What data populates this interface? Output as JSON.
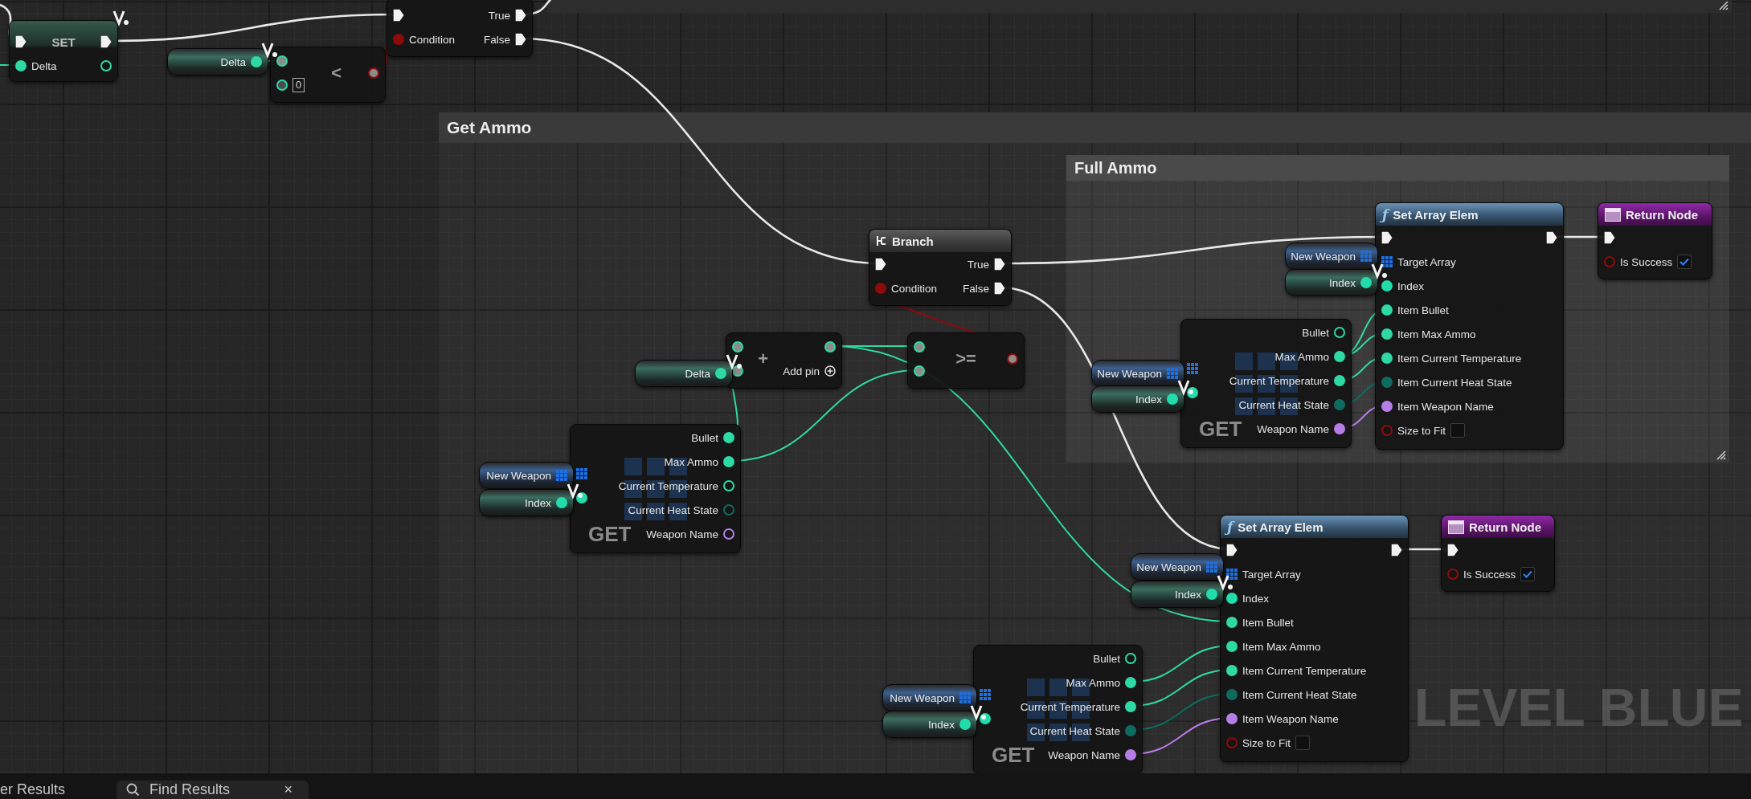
{
  "comments": [
    {
      "title": "Get Ammo"
    },
    {
      "title": "Full Ammo"
    }
  ],
  "nodes": [
    {
      "kind": "set",
      "title": "SET",
      "inputs": [
        {
          "kind": "exec",
          "connected": true
        },
        {
          "label": "Delta",
          "kind": "float",
          "connected": true
        }
      ],
      "outputs": [
        {
          "kind": "exec",
          "connected": true
        },
        {
          "kind": "float",
          "connected": false
        }
      ]
    },
    {
      "kind": "getter",
      "label": "Delta",
      "pin": {
        "kind": "float",
        "connected": true
      }
    },
    {
      "kind": "operator",
      "symbol": "<",
      "inputs": [
        {
          "kind": "wildcard",
          "connected": true
        },
        {
          "kind": "wildcard",
          "connected": false,
          "literal": "0"
        }
      ],
      "outputs": [
        {
          "kind": "wildcard_bool",
          "connected": true
        }
      ]
    },
    {
      "kind": "branch",
      "inputs": [
        {
          "kind": "exec",
          "connected": true
        },
        {
          "label": "Condition",
          "kind": "bool",
          "connected": true
        }
      ],
      "outputs": [
        {
          "label": "True",
          "kind": "exec",
          "connected": true
        },
        {
          "label": "False",
          "kind": "exec",
          "connected": true
        }
      ]
    },
    {
      "kind": "branch",
      "title": "Branch",
      "inputs": [
        {
          "kind": "exec",
          "connected": true
        },
        {
          "label": "Condition",
          "kind": "bool",
          "connected": true
        }
      ],
      "outputs": [
        {
          "label": "True",
          "kind": "exec",
          "connected": true
        },
        {
          "label": "False",
          "kind": "exec",
          "connected": true
        }
      ]
    },
    {
      "kind": "getter",
      "label": "Delta",
      "pin": {
        "kind": "float",
        "connected": true
      }
    },
    {
      "kind": "add",
      "symbol": "+",
      "add_pin": "Add pin",
      "inputs": [
        {
          "kind": "wildcard",
          "connected": true
        },
        {
          "kind": "wildcard",
          "connected": true
        }
      ],
      "outputs": [
        {
          "kind": "wildcard",
          "connected": true
        }
      ]
    },
    {
      "kind": "operator",
      "symbol": ">=",
      "inputs": [
        {
          "kind": "wildcard",
          "connected": true
        },
        {
          "kind": "wildcard",
          "connected": true
        }
      ],
      "outputs": [
        {
          "kind": "wildcard_bool",
          "connected": true
        }
      ]
    },
    {
      "kind": "get",
      "title": "GET",
      "inputs": [
        {
          "kind": "array",
          "connected": true
        },
        {
          "kind": "int",
          "connected": true
        }
      ],
      "outputs": [
        {
          "label": "Bullet",
          "kind": "float",
          "connected": true
        },
        {
          "label": "Max Ammo",
          "kind": "float",
          "connected": true
        },
        {
          "label": "Current Temperature",
          "kind": "float",
          "connected": false
        },
        {
          "label": "Current Heat State",
          "kind": "enum",
          "connected": false
        },
        {
          "label": "Weapon Name",
          "kind": "name",
          "connected": false
        }
      ]
    },
    {
      "kind": "getter",
      "label": "New Weapon",
      "pin": {
        "kind": "array",
        "connected": true
      }
    },
    {
      "kind": "getter",
      "label": "Index",
      "pin": {
        "kind": "int",
        "connected": true
      }
    },
    {
      "kind": "getter",
      "label": "New Weapon",
      "pin": {
        "kind": "array",
        "connected": true
      }
    },
    {
      "kind": "getter",
      "label": "Index",
      "pin": {
        "kind": "int",
        "connected": true
      }
    },
    {
      "kind": "function",
      "icon": "ƒ",
      "title": "Set Array Elem",
      "inputs": [
        {
          "kind": "exec",
          "connected": true
        },
        {
          "label": "Target Array",
          "kind": "array",
          "connected": true
        },
        {
          "label": "Index",
          "kind": "int",
          "connected": true
        },
        {
          "label": "Item Bullet",
          "kind": "float",
          "connected": true
        },
        {
          "label": "Item Max Ammo",
          "kind": "float",
          "connected": true
        },
        {
          "label": "Item Current Temperature",
          "kind": "float",
          "connected": true
        },
        {
          "label": "Item Current Heat State",
          "kind": "enum",
          "connected": true
        },
        {
          "label": "Item Weapon Name",
          "kind": "name",
          "connected": true
        },
        {
          "label": "Size to Fit",
          "kind": "bool",
          "connected": false,
          "checked": false
        }
      ],
      "outputs": [
        {
          "kind": "exec",
          "connected": true
        }
      ]
    },
    {
      "kind": "return",
      "title": "Return Node",
      "inputs": [
        {
          "kind": "exec",
          "connected": true
        },
        {
          "label": "Is Success",
          "kind": "bool",
          "connected": false,
          "checked": true
        }
      ]
    },
    {
      "kind": "getter",
      "label": "New Weapon",
      "pin": {
        "kind": "array",
        "connected": true
      }
    },
    {
      "kind": "getter",
      "label": "Index",
      "pin": {
        "kind": "int",
        "connected": true
      }
    },
    {
      "kind": "get",
      "title": "GET",
      "inputs": [
        {
          "kind": "array",
          "connected": true
        },
        {
          "kind": "int",
          "connected": true
        }
      ],
      "outputs": [
        {
          "label": "Bullet",
          "kind": "float",
          "connected": false
        },
        {
          "label": "Max Ammo",
          "kind": "float",
          "connected": true
        },
        {
          "label": "Current Temperature",
          "kind": "float",
          "connected": true
        },
        {
          "label": "Current Heat State",
          "kind": "enum",
          "connected": true
        },
        {
          "label": "Weapon Name",
          "kind": "name",
          "connected": true
        }
      ]
    },
    {
      "kind": "getter",
      "label": "New Weapon",
      "pin": {
        "kind": "array",
        "connected": true
      }
    },
    {
      "kind": "getter",
      "label": "Index",
      "pin": {
        "kind": "int",
        "connected": true
      }
    },
    {
      "kind": "function",
      "icon": "ƒ",
      "title": "Set Array Elem",
      "inputs": [
        {
          "kind": "exec",
          "connected": true
        },
        {
          "label": "Target Array",
          "kind": "array",
          "connected": true
        },
        {
          "label": "Index",
          "kind": "int",
          "connected": true
        },
        {
          "label": "Item Bullet",
          "kind": "float",
          "connected": true
        },
        {
          "label": "Item Max Ammo",
          "kind": "float",
          "connected": true
        },
        {
          "label": "Item Current Temperature",
          "kind": "float",
          "connected": true
        },
        {
          "label": "Item Current Heat State",
          "kind": "enum",
          "connected": true
        },
        {
          "label": "Item Weapon Name",
          "kind": "name",
          "connected": true
        },
        {
          "label": "Size to Fit",
          "kind": "bool",
          "connected": false,
          "checked": false
        }
      ],
      "outputs": [
        {
          "kind": "exec",
          "connected": true
        }
      ]
    },
    {
      "kind": "return",
      "title": "Return Node",
      "inputs": [
        {
          "kind": "exec",
          "connected": true
        },
        {
          "label": "Is Success",
          "kind": "bool",
          "connected": false,
          "checked": true
        }
      ]
    },
    {
      "kind": "getter",
      "label": "New Weapon",
      "pin": {
        "kind": "array",
        "connected": true
      }
    },
    {
      "kind": "getter",
      "label": "Index",
      "pin": {
        "kind": "int",
        "connected": true
      }
    },
    {
      "kind": "get",
      "title": "GET",
      "inputs": [
        {
          "kind": "array",
          "connected": true
        },
        {
          "kind": "int",
          "connected": true
        }
      ],
      "outputs": [
        {
          "label": "Bullet",
          "kind": "float",
          "connected": false
        },
        {
          "label": "Max Ammo",
          "kind": "float",
          "connected": true
        },
        {
          "label": "Current Temperature",
          "kind": "float",
          "connected": true
        },
        {
          "label": "Current Heat State",
          "kind": "enum",
          "connected": true
        },
        {
          "label": "Weapon Name",
          "kind": "name",
          "connected": true
        }
      ]
    }
  ],
  "graph_label": "LEVEL BLUE",
  "bottom_tabs": [
    {
      "kind": "plain",
      "label": "er Results",
      "selected": false
    },
    {
      "kind": "search",
      "label": "Find Results",
      "selected": true,
      "close": "×"
    }
  ]
}
